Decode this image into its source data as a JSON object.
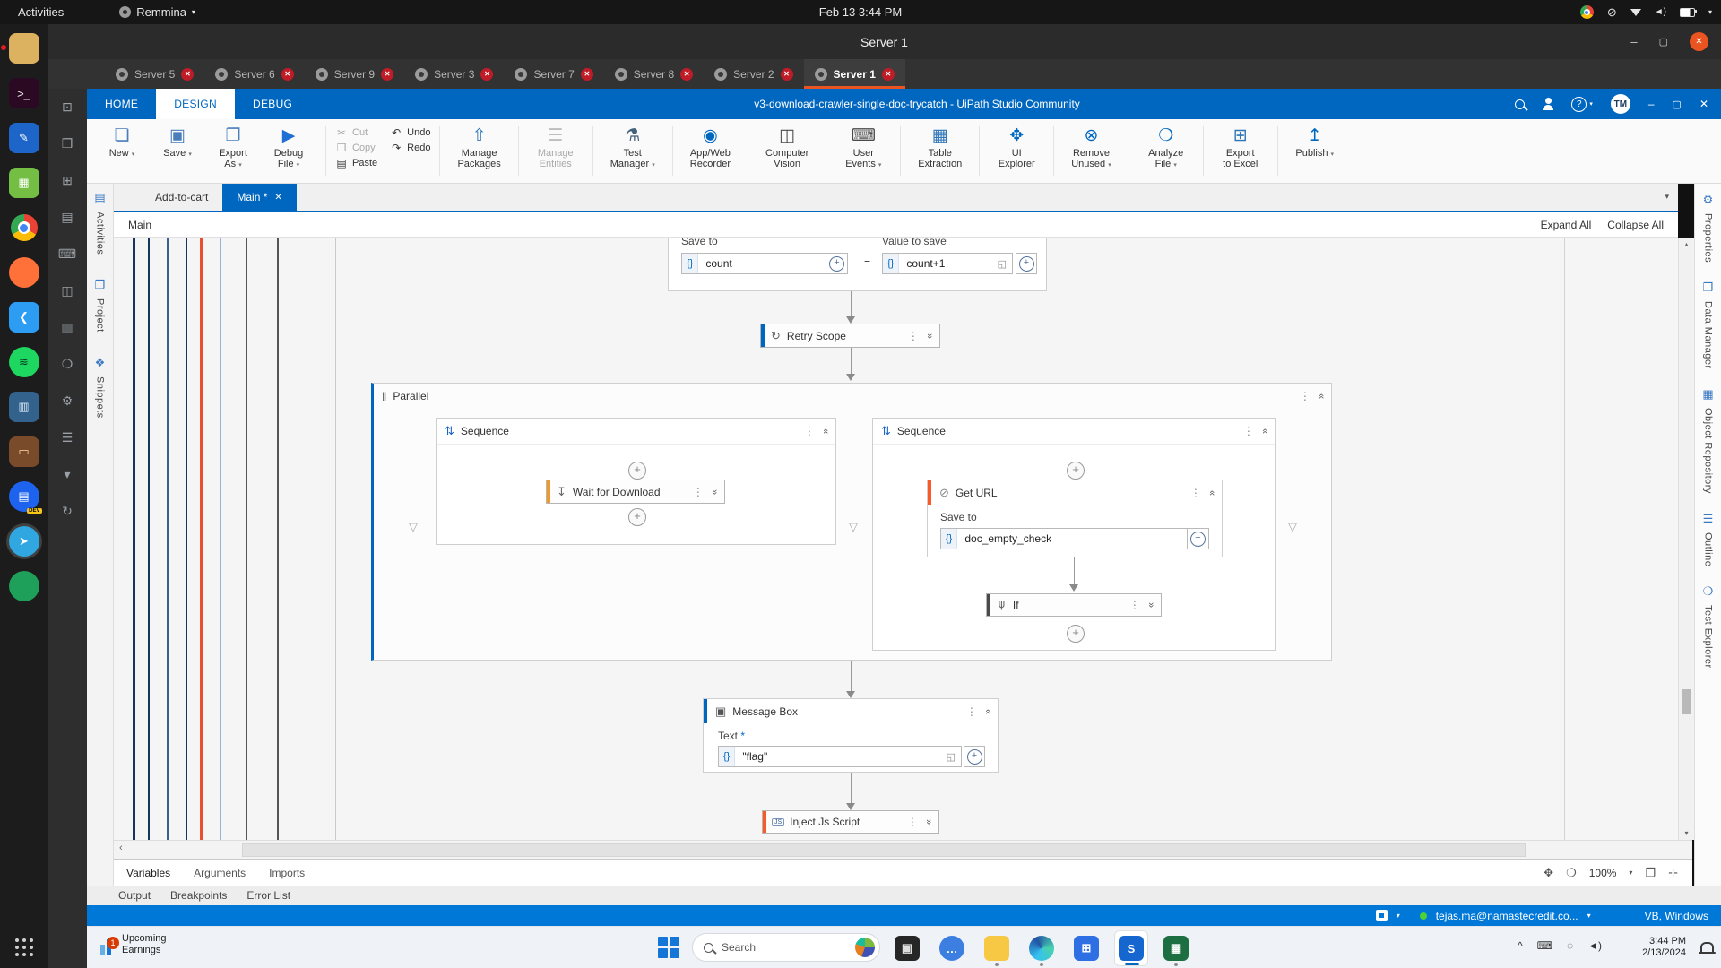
{
  "theme": {
    "accent_blue": "#0067c0",
    "ubuntu_orange": "#e95420",
    "status_blue": "#0078d7",
    "activity_orange": "#f09a2e",
    "activity_red": "#fa5a28",
    "tab_close_red": "#c01c28"
  },
  "ubuntu": {
    "topbar": {
      "activities_label": "Activities",
      "app_menu": "Remmina",
      "menu_caret": "▾",
      "clock": "Feb 13  3:44 PM",
      "dnd_glyph": "⊘",
      "volume_glyph": "◄)",
      "caret_glyph": "▾"
    },
    "dock": [
      {
        "name": "files-icon",
        "bg": "#dcb261",
        "glyph": "",
        "fg": "#7a5a1e",
        "dot": true
      },
      {
        "name": "terminal-icon",
        "bg": "#2c0922",
        "glyph": ">_",
        "fg": "#eee"
      },
      {
        "name": "text-editor-icon",
        "bg": "#1e65c9",
        "glyph": "✎",
        "fg": "#fff"
      },
      {
        "name": "libreoffice-calc-icon",
        "bg": "#74bf43",
        "glyph": "▦",
        "fg": "#fff"
      },
      {
        "name": "chrome-icon",
        "type": "chrome"
      },
      {
        "name": "firefox-icon",
        "type": "circle",
        "bg": "#ff7139",
        "glyph": "",
        "fg": "#fff"
      },
      {
        "name": "vscode-icon",
        "bg": "#2d9df4",
        "glyph": "❮",
        "fg": "#fff"
      },
      {
        "name": "spotify-icon",
        "type": "circle",
        "bg": "#1ed760",
        "glyph": "≋",
        "fg": "#0a3a20"
      },
      {
        "name": "pgadmin-icon",
        "bg": "#33628c",
        "glyph": "▥",
        "fg": "#d8e6f4"
      },
      {
        "name": "toolbox-icon",
        "bg": "#7a4b2a",
        "glyph": "▭",
        "fg": "#ffd9a0"
      },
      {
        "name": "docker-dev-icon",
        "type": "circle",
        "bg": "#1d63ed",
        "glyph": "▤",
        "fg": "#fff",
        "badge": "DEV"
      },
      {
        "name": "remmina-icon",
        "type": "circle",
        "bg": "#30a7e0",
        "glyph": "➤",
        "fg": "#fff",
        "active": true
      },
      {
        "name": "green-app-icon",
        "type": "circle",
        "bg": "#1fa05a",
        "glyph": "",
        "fg": "#fff"
      },
      {
        "name": "show-apps-icon",
        "type": "grid"
      }
    ]
  },
  "remmina": {
    "window_title": "Server 1",
    "window_controls": {
      "minimize": "–",
      "maximize": "▢",
      "close": "✕"
    },
    "tabs": [
      {
        "label": "Server 5"
      },
      {
        "label": "Server 6"
      },
      {
        "label": "Server 9"
      },
      {
        "label": "Server 3"
      },
      {
        "label": "Server 7"
      },
      {
        "label": "Server 8"
      },
      {
        "label": "Server 2"
      },
      {
        "label": "Server 1",
        "active": true
      }
    ],
    "tab_close_glyph": "✕",
    "toolbar": [
      {
        "name": "window-icon",
        "glyph": "⊡"
      },
      {
        "name": "fullscreen-icon",
        "glyph": "❒"
      },
      {
        "name": "dynamic-resolution-icon",
        "glyph": "⊞"
      },
      {
        "name": "scaling-icon",
        "glyph": "▤"
      },
      {
        "name": "keyboard-grab-icon",
        "glyph": "⌨"
      },
      {
        "name": "screenshot-icon",
        "glyph": "◫"
      },
      {
        "name": "multi-monitor-icon",
        "glyph": "▥"
      },
      {
        "name": "magnifier-icon",
        "glyph": "❍"
      },
      {
        "name": "preferences-icon",
        "glyph": "⚙"
      },
      {
        "name": "menu-icon",
        "glyph": "☰"
      },
      {
        "name": "minimize-toolbar-icon",
        "glyph": "▾"
      },
      {
        "name": "disconnect-icon",
        "glyph": "↻"
      }
    ]
  },
  "uipath": {
    "menu_tabs": [
      {
        "label": "HOME"
      },
      {
        "label": "DESIGN",
        "active": true
      },
      {
        "label": "DEBUG"
      }
    ],
    "window_title": "v3-download-crawler-single-doc-trycatch - UiPath Studio Community",
    "titlebar": {
      "help": "?",
      "help_caret": "▾",
      "avatar": "TM",
      "minimize": "–",
      "maximize": "▢",
      "close": "✕"
    },
    "ribbon": {
      "file_buttons": [
        {
          "name": "new-button",
          "glyph": "❏",
          "color": "#4a7ebb",
          "lines": [
            "New"
          ],
          "chev": true
        },
        {
          "name": "save-button",
          "glyph": "▣",
          "color": "#4a7ebb",
          "lines": [
            "Save"
          ],
          "chev": true
        },
        {
          "name": "export-as-button",
          "glyph": "❐",
          "color": "#4a7ebb",
          "lines": [
            "Export",
            "As"
          ],
          "chev": true
        },
        {
          "name": "debug-file-button",
          "glyph": "▶",
          "color": "#1f6fd4",
          "lines": [
            "Debug",
            "File"
          ],
          "chev": true
        }
      ],
      "edit_col1": [
        {
          "name": "cut-button",
          "glyph": "✂",
          "label": "Cut",
          "disabled": true
        },
        {
          "name": "copy-button",
          "glyph": "❐",
          "label": "Copy",
          "disabled": true
        },
        {
          "name": "paste-button",
          "glyph": "▤",
          "label": "Paste"
        }
      ],
      "edit_col2": [
        {
          "name": "undo-button",
          "glyph": "↶",
          "label": "Undo"
        },
        {
          "name": "redo-button",
          "glyph": "↷",
          "label": "Redo"
        }
      ],
      "tool_buttons": [
        {
          "name": "manage-packages-button",
          "glyph": "⇧",
          "color": "#2e75b6",
          "lines": [
            "Manage",
            "Packages"
          ]
        },
        {
          "name": "manage-entities-button",
          "glyph": "☰",
          "color": "#bdbdbd",
          "lines": [
            "Manage",
            "Entities"
          ],
          "disabled": true
        },
        {
          "name": "test-manager-button",
          "glyph": "⚗",
          "color": "#44607a",
          "lines": [
            "Test",
            "Manager"
          ],
          "chev": true
        },
        {
          "name": "app-web-recorder-button",
          "glyph": "◉",
          "color": "#0067c0",
          "lines": [
            "App/Web",
            "Recorder"
          ]
        },
        {
          "name": "computer-vision-button",
          "glyph": "◫",
          "color": "#4a4a4a",
          "lines": [
            "Computer",
            "Vision"
          ]
        },
        {
          "name": "user-events-button",
          "glyph": "⌨",
          "color": "#4a4a4a",
          "lines": [
            "User",
            "Events"
          ],
          "chev": true
        },
        {
          "name": "table-extraction-button",
          "glyph": "▦",
          "color": "#2e75b6",
          "lines": [
            "Table",
            "Extraction"
          ]
        },
        {
          "name": "ui-explorer-button",
          "glyph": "✥",
          "color": "#0067c0",
          "lines": [
            "UI",
            "Explorer"
          ]
        },
        {
          "name": "remove-unused-button",
          "glyph": "⊗",
          "color": "#0067c0",
          "lines": [
            "Remove",
            "Unused"
          ],
          "chev": true
        },
        {
          "name": "analyze-file-button",
          "glyph": "❍",
          "color": "#0067c0",
          "lines": [
            "Analyze",
            "File"
          ],
          "chev": true
        },
        {
          "name": "export-to-excel-button",
          "glyph": "⊞",
          "color": "#2e75b6",
          "lines": [
            "Export",
            "to Excel"
          ]
        },
        {
          "name": "publish-button",
          "glyph": "↥",
          "color": "#0067c0",
          "lines": [
            "Publish"
          ],
          "chev": true
        }
      ]
    },
    "left_tabs": [
      {
        "name": "tab-activities",
        "glyph": "▤",
        "label": "Activities"
      },
      {
        "name": "tab-project",
        "glyph": "❒",
        "label": "Project"
      },
      {
        "name": "tab-snippets",
        "glyph": "❖",
        "label": "Snippets"
      }
    ],
    "right_tabs": [
      {
        "name": "tab-properties",
        "glyph": "⚙",
        "label": "Properties"
      },
      {
        "name": "tab-data-manager",
        "glyph": "❒",
        "label": "Data Manager"
      },
      {
        "name": "tab-object-repository",
        "glyph": "▦",
        "label": "Object Repository"
      },
      {
        "name": "tab-outline",
        "glyph": "☰",
        "label": "Outline"
      },
      {
        "name": "tab-test-explorer",
        "glyph": "❍",
        "label": "Test Explorer"
      }
    ],
    "doc_tabs": [
      {
        "label": "Add-to-cart"
      },
      {
        "label": "Main *",
        "active": true,
        "close": "✕"
      }
    ],
    "doc_tab_overflow": "▾",
    "breadcrumb": {
      "path": "Main",
      "expand_all": "Expand All",
      "collapse_all": "Collapse All"
    },
    "glyphs": {
      "dots": "⋮",
      "chev_collapse": "«",
      "chev_expand": "»",
      "plus": "+",
      "triangle": "▽",
      "retry": "↻",
      "parallel": "‖",
      "sequence": "⇅",
      "wait": "↧",
      "geturl": "⊘",
      "if": "⋔",
      "msgbox": "▣",
      "popout": "◱",
      "up": "▴",
      "down": "▾",
      "left": "‹"
    },
    "workflow": {
      "brace": "{}",
      "assign": {
        "save_to_label": "Save to",
        "save_to_value": "count",
        "equals": "=",
        "value_label": "Value to save",
        "value": "count+1"
      },
      "retry_scope": {
        "label": "Retry Scope"
      },
      "parallel": {
        "label": "Parallel"
      },
      "sequence_left": {
        "label": "Sequence",
        "wait_for_download": {
          "label": "Wait for Download"
        }
      },
      "sequence_right": {
        "label": "Sequence",
        "get_url": {
          "label": "Get URL",
          "save_to_label": "Save to",
          "value": "doc_empty_check"
        },
        "if_activity": {
          "label": "If"
        }
      },
      "message_box": {
        "label": "Message Box",
        "text_label": "Text",
        "required_mark": "*",
        "value": "\"flag\""
      },
      "inject_js": {
        "label": "Inject Js Script",
        "icon_text": "JS"
      }
    },
    "panel_tabs_top": [
      "Variables",
      "Arguments",
      "Imports"
    ],
    "panel_tabs_bottom": [
      "Output",
      "Breakpoints",
      "Error List"
    ],
    "zoom_controls": {
      "pan": "✥",
      "zoom": "❍",
      "level": "100%",
      "caret": "▾",
      "fit": "❒",
      "center": "⊹"
    },
    "statusbar": {
      "account": "tejas.ma@namastecredit.co...",
      "account_caret": "▾",
      "language": "VB, Windows"
    }
  },
  "windows": {
    "taskbar": {
      "widget": {
        "badge": "1",
        "line1": "Upcoming",
        "line2": "Earnings"
      },
      "search_placeholder": "Search",
      "apps": [
        {
          "name": "photos-app-icon",
          "bg": "#262626",
          "glyph": "▣",
          "fg": "#ddd"
        },
        {
          "name": "chat-app-icon",
          "type": "circle",
          "bg": "#3d7fe0",
          "glyph": "…",
          "fg": "#fff"
        },
        {
          "name": "file-explorer-icon",
          "bg": "#f7c843",
          "glyph": "",
          "fg": "#b07f17",
          "dot": true
        },
        {
          "name": "edge-icon",
          "type": "edge",
          "dot": true
        },
        {
          "name": "store-icon",
          "bg": "#2f6fe4",
          "glyph": "⊞",
          "fg": "#fff"
        },
        {
          "name": "uipath-studio-icon",
          "bg": "#1666d0",
          "glyph": "S",
          "fg": "#fff",
          "active": true
        },
        {
          "name": "excel-icon",
          "bg": "#1d6f42",
          "glyph": "▦",
          "fg": "#fff",
          "dot": true
        }
      ],
      "tray": [
        {
          "name": "hidden-icons-chevron",
          "glyph": "^"
        },
        {
          "name": "touch-keyboard-icon",
          "glyph": "⌨"
        },
        {
          "name": "network-icon",
          "glyph": "◌"
        },
        {
          "name": "volume-icon",
          "glyph": "◄)"
        }
      ],
      "clock": {
        "time": "3:44 PM",
        "date": "2/13/2024"
      }
    }
  }
}
